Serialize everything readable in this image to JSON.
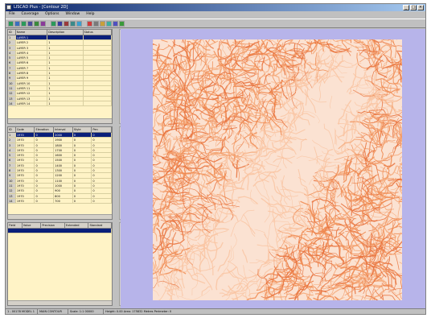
{
  "window": {
    "title": "LISCAD Plus - [Contour 2D]"
  },
  "menu": [
    "File",
    "Coverage",
    "Options",
    "Window",
    "Help"
  ],
  "toolbar": {
    "colors": [
      "#2a9a5a",
      "#3a6fbf",
      "#2a9a5a",
      "#4a4a9a",
      "#3a8a3a",
      "#8a3a9a",
      "#2a9a5a",
      "#3a3aa0",
      "#9a3a3a",
      "#3a8a8a",
      "#3aa0d0",
      "#d03a3a",
      "#7a7a7a",
      "#c8a03a",
      "#3ab0a0",
      "#5050c0",
      "#3a9a3a"
    ]
  },
  "table1": {
    "headers": [
      "ID",
      "Name",
      "Description",
      "Status"
    ],
    "rows": [
      {
        "id": "1",
        "name": "LAYER 1",
        "desc": "",
        "status": ""
      },
      {
        "id": "2",
        "name": "LAYER 2",
        "desc": "1",
        "status": ""
      },
      {
        "id": "3",
        "name": "LAYER 3",
        "desc": "1",
        "status": ""
      },
      {
        "id": "4",
        "name": "LAYER 4",
        "desc": "1",
        "status": ""
      },
      {
        "id": "5",
        "name": "LAYER 5",
        "desc": "1",
        "status": ""
      },
      {
        "id": "6",
        "name": "LAYER 6",
        "desc": "1",
        "status": ""
      },
      {
        "id": "7",
        "name": "LAYER 7",
        "desc": "1",
        "status": ""
      },
      {
        "id": "8",
        "name": "LAYER 8",
        "desc": "1",
        "status": ""
      },
      {
        "id": "9",
        "name": "LAYER 9",
        "desc": "1",
        "status": ""
      },
      {
        "id": "10",
        "name": "LAYER 10",
        "desc": "1",
        "status": ""
      },
      {
        "id": "11",
        "name": "LAYER 11",
        "desc": "1",
        "status": ""
      },
      {
        "id": "12",
        "name": "LAYER 12",
        "desc": "1",
        "status": ""
      },
      {
        "id": "13",
        "name": "LAYER 13",
        "desc": "1",
        "status": ""
      },
      {
        "id": "14",
        "name": "LAYER 14",
        "desc": "1",
        "status": ""
      }
    ]
  },
  "table2": {
    "headers": [
      "ID",
      "Code",
      "Elevation",
      "Interval",
      "Style",
      "Pen"
    ],
    "rows": [
      {
        "c": [
          "1",
          "1970",
          "0",
          "2000",
          "0",
          "0"
        ]
      },
      {
        "c": [
          "2",
          "1970",
          "0",
          "1900",
          "0",
          "0"
        ]
      },
      {
        "c": [
          "3",
          "1970",
          "0",
          "1800",
          "0",
          "0"
        ]
      },
      {
        "c": [
          "4",
          "1970",
          "0",
          "1700",
          "0",
          "0"
        ]
      },
      {
        "c": [
          "5",
          "1970",
          "0",
          "1600",
          "0",
          "0"
        ]
      },
      {
        "c": [
          "6",
          "1970",
          "0",
          "1500",
          "0",
          "0"
        ]
      },
      {
        "c": [
          "7",
          "1970",
          "0",
          "1400",
          "0",
          "0"
        ]
      },
      {
        "c": [
          "8",
          "1970",
          "0",
          "1300",
          "0",
          "0"
        ]
      },
      {
        "c": [
          "9",
          "1970",
          "0",
          "1200",
          "0",
          "0"
        ]
      },
      {
        "c": [
          "10",
          "1970",
          "0",
          "1100",
          "0",
          "0"
        ]
      },
      {
        "c": [
          "11",
          "1970",
          "0",
          "1000",
          "0",
          "0"
        ]
      },
      {
        "c": [
          "12",
          "1970",
          "0",
          "900",
          "0",
          "0"
        ]
      },
      {
        "c": [
          "13",
          "1970",
          "0",
          "800",
          "0",
          "0"
        ]
      },
      {
        "c": [
          "14",
          "1970",
          "0",
          "700",
          "0",
          "0"
        ]
      }
    ]
  },
  "table3": {
    "headers": [
      "Field",
      "Value",
      "Precision",
      "Extended",
      "Standard"
    ]
  },
  "status": {
    "s1": "1 - 00178 MODEL 1",
    "s2": "MAIN CONTOUR",
    "s3": "Scale: 1:1 00000",
    "s4": "Height: 0.00   Area: 175832 Metres   Perimeter: 0"
  },
  "map": {
    "contour_colors": [
      "#f08a50",
      "#f5a878",
      "#e8703a",
      "#f9c4a2"
    ]
  }
}
